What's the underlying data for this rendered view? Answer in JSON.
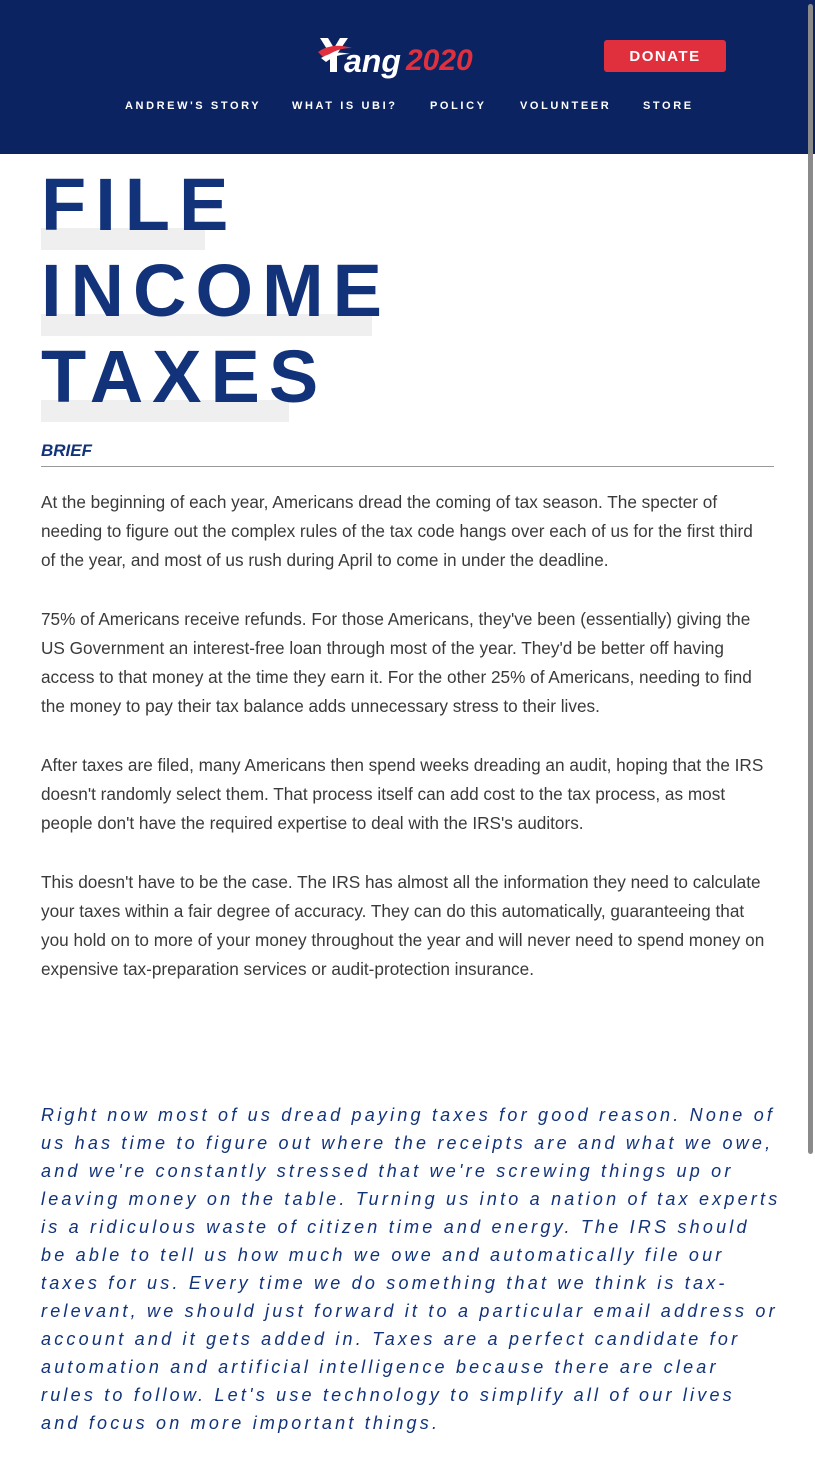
{
  "header": {
    "logo_text": "Yang2020",
    "donate_label": "DONATE",
    "nav": [
      {
        "label": "ANDREW'S STORY"
      },
      {
        "label": "WHAT IS UBI?"
      },
      {
        "label": "POLICY"
      },
      {
        "label": "VOLUNTEER"
      },
      {
        "label": "STORE"
      }
    ]
  },
  "colors": {
    "header_bg": "#0b2461",
    "accent_red": "#e0303e",
    "title_blue": "#12337a"
  },
  "policy": {
    "title_lines": [
      "FILE",
      "INCOME",
      "TAXES"
    ],
    "section_label": "BRIEF",
    "paragraphs": [
      "At the beginning of each year, Americans dread the coming of tax season. The specter of needing to figure out the complex rules of the tax code hangs over each of us for the first third of the year, and most of us rush during April to come in under the deadline.",
      "75% of Americans receive refunds. For those Americans, they've been (essentially) giving the US Government an interest-free loan through most of the year. They'd be better off having access to that money at the time they earn it. For the other 25% of Americans, needing to find the money to pay their tax balance adds unnecessary stress to their lives.",
      "After taxes are filed, many Americans then spend weeks dreading an audit, hoping that the IRS doesn't randomly select them. That process itself can add cost to the tax process, as most people don't have the required expertise to deal with the IRS's auditors.",
      "This doesn't have to be the case. The IRS has almost all the information they need to calculate your taxes within a fair degree of accuracy. They can do this automatically, guaranteeing that you hold on to more of your money throughout the year and will never need to spend money on expensive tax-preparation services or audit-protection insurance."
    ],
    "quote": "Right now most of us dread paying taxes for good reason. None of us has time to figure out where the receipts are and what we owe, and we're constantly stressed that we're screwing things up or leaving money on the table. Turning us into a nation of tax experts is a ridiculous waste of citizen time and energy. The IRS should be able to tell us how much we owe and automatically file our taxes for us. Every time we do something that we think is tax-relevant, we should just forward it to a particular email address or account and it gets added in. Taxes are a perfect candidate for automation and artificial intelligence because there are clear rules to follow. Let's use technology to simplify all of our lives and focus on more important things."
  }
}
